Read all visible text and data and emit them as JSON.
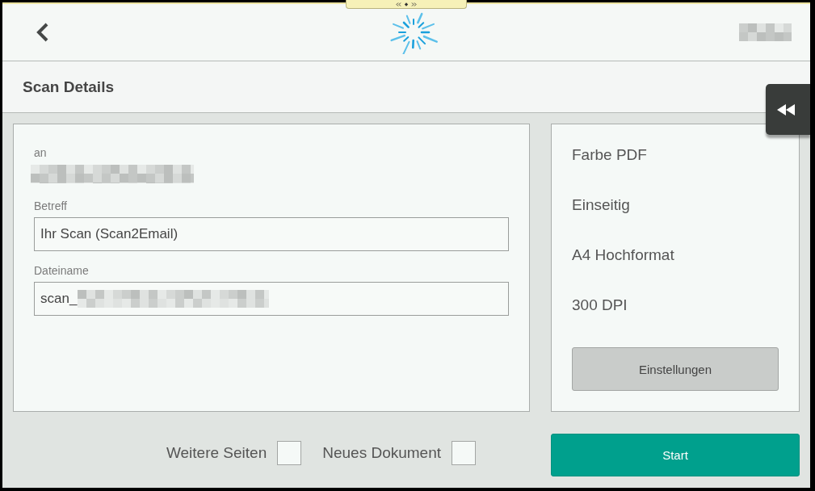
{
  "title_bar": {
    "title": "Scan Details"
  },
  "recipient": {
    "label": "an"
  },
  "fields": [
    {
      "label": "Betreff",
      "value": "Ihr Scan (Scan2Email)",
      "redacted": false
    },
    {
      "label": "Dateiname",
      "value": "scan_",
      "redacted": true
    }
  ],
  "scan_settings": [
    "Farbe PDF",
    "Einseitig",
    "A4 Hochformat",
    "300 DPI"
  ],
  "settings_button": "Einstellungen",
  "options": [
    {
      "label": "Weitere Seiten",
      "checked": false
    },
    {
      "label": "Neues Dokument",
      "checked": false
    }
  ],
  "start_button": "Start"
}
